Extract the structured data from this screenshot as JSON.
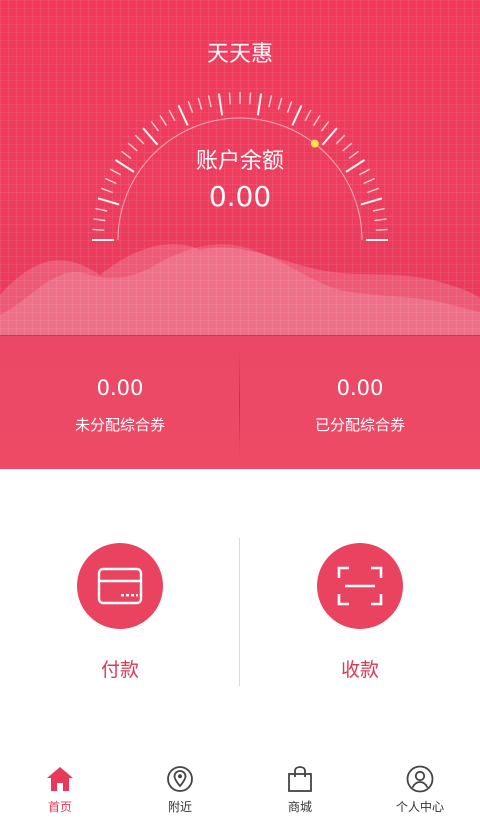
{
  "header": {
    "app_title": "天天惠",
    "balance_label": "账户余额",
    "balance_value": "0.00"
  },
  "vouchers": [
    {
      "amount": "0.00",
      "label": "未分配综合券"
    },
    {
      "amount": "0.00",
      "label": "已分配综合券"
    }
  ],
  "actions": {
    "pay_label": "付款",
    "receive_label": "收款"
  },
  "tabbar": {
    "items": [
      {
        "label": "首页",
        "icon": "home-icon",
        "active": true
      },
      {
        "label": "附近",
        "icon": "location-pin-icon",
        "active": false
      },
      {
        "label": "商城",
        "icon": "shopping-bag-icon",
        "active": false
      },
      {
        "label": "个人中心",
        "icon": "user-icon",
        "active": false
      }
    ]
  },
  "colors": {
    "primary": "#ee3d5f",
    "accent_text": "#d83a57",
    "gauge_indicator": "#ffe24a"
  }
}
